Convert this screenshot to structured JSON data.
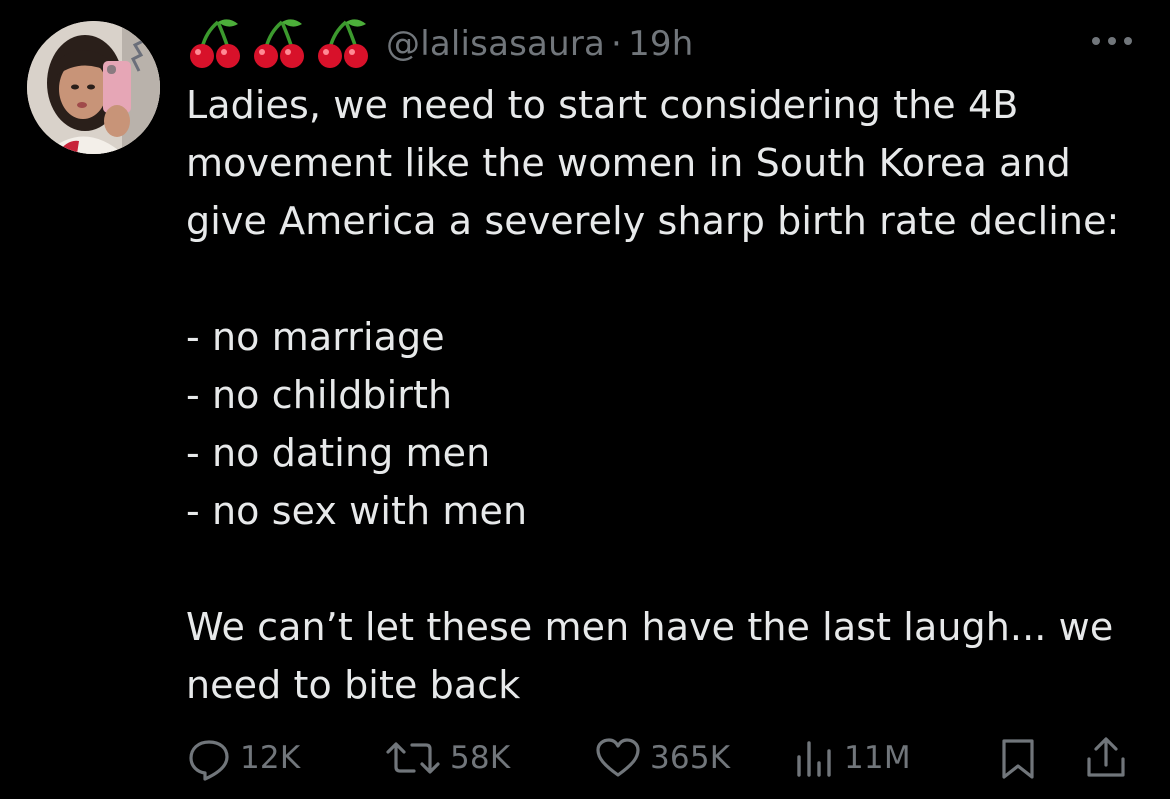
{
  "tweet": {
    "display_name_icons": [
      "cherry-emoji",
      "cherry-emoji",
      "cherry-emoji"
    ],
    "handle": "@lalisasaura",
    "separator": "·",
    "time": "19h",
    "more_icon": "more-dots-icon",
    "text": {
      "para1": [
        "Ladies, we need to start considering the 4B",
        "movement like the women in South Korea and",
        "give America a severely sharp birth rate decline:"
      ],
      "list": [
        "- no marriage",
        "- no childbirth",
        "- no dating men",
        "- no sex with men"
      ],
      "para2": [
        "We can’t let these men have the last laugh... we",
        "need to bite back"
      ]
    },
    "actions": {
      "reply": {
        "icon": "reply-icon",
        "count": "12K"
      },
      "repost": {
        "icon": "repost-icon",
        "count": "58K"
      },
      "like": {
        "icon": "heart-icon",
        "count": "365K"
      },
      "views": {
        "icon": "views-icon",
        "count": "11M"
      },
      "bookmark": {
        "icon": "bookmark-icon"
      },
      "share": {
        "icon": "share-icon"
      }
    },
    "colors": {
      "background": "#000000",
      "text": "#e7e9ea",
      "secondary": "#71767b",
      "cherry": "#d8112a",
      "stem": "#3c9a2e"
    }
  }
}
